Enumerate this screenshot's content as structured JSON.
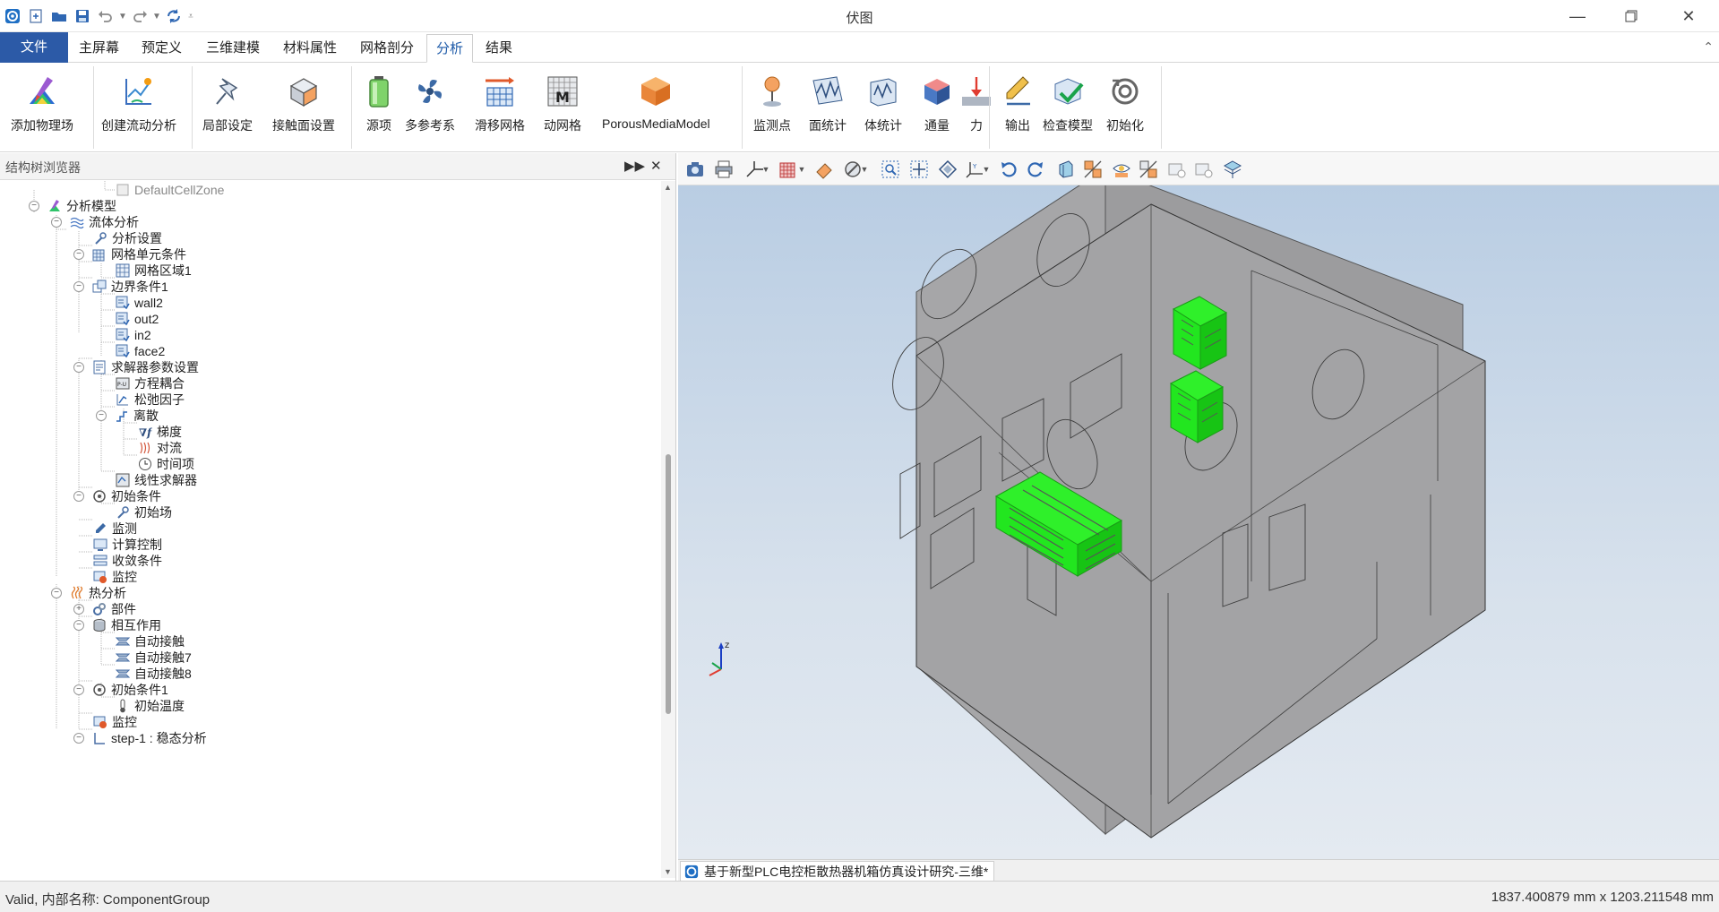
{
  "window": {
    "title": "伏图",
    "controls": [
      "minimize-icon",
      "restore-icon",
      "close-icon"
    ]
  },
  "quick_access": [
    "app-logo-icon",
    "new-file-icon",
    "open-folder-icon",
    "save-icon",
    "undo-icon",
    "redo-icon",
    "refresh-icon",
    "customize-icon"
  ],
  "menu": {
    "tabs": [
      "文件",
      "主屏幕",
      "预定义",
      "三维建模",
      "材料属性",
      "网格剖分",
      "分析",
      "结果"
    ],
    "active": "分析"
  },
  "ribbon": {
    "buttons": {
      "add_physics": "添加物理场",
      "create_flow": "创建流动分析",
      "local_setting": "局部设定",
      "contact_setting": "接触面设置",
      "source": "源项",
      "multi_ref": "多参考系",
      "sliding_mesh": "滑移网格",
      "dynamic_mesh": "动网格",
      "porous_media": "PorousMediaModel",
      "monitor_point": "监测点",
      "surface_stat": "面统计",
      "volume_stat": "体统计",
      "flux": "通量",
      "force": "力",
      "output": "输出",
      "check_model": "检查模型",
      "initialize": "初始化"
    }
  },
  "left_pane": {
    "title": "结构树浏览器",
    "tree": {
      "default_cell_zone": "DefaultCellZone",
      "analysis_model": "分析模型",
      "fluid_analysis": "流体分析",
      "analysis_settings": "分析设置",
      "mesh_cell_conditions": "网格单元条件",
      "mesh_region1": "网格区域1",
      "boundary_conditions1": "边界条件1",
      "wall2": "wall2",
      "out2": "out2",
      "in2": "in2",
      "face2": "face2",
      "solver_params": "求解器参数设置",
      "equation_coupling": "方程耦合",
      "relaxation": "松弛因子",
      "discrete": "离散",
      "gradient": "梯度",
      "convection": "对流",
      "time_term": "时间项",
      "linear_solver": "线性求解器",
      "initial_conditions": "初始条件",
      "initial_field": "初始场",
      "monitoring": "监测",
      "calc_control": "计算控制",
      "convergence": "收敛条件",
      "monitor_ctrl": "监控",
      "thermal_analysis": "热分析",
      "parts": "部件",
      "interactions": "相互作用",
      "auto_contact": "自动接触",
      "auto_contact7": "自动接触7",
      "auto_contact8": "自动接触8",
      "initial_conditions1": "初始条件1",
      "initial_temperature": "初始温度",
      "monitor_ctrl2": "监控",
      "step1": "step-1 : 稳态分析"
    }
  },
  "viewport": {
    "document_tab": "基于新型PLC电控柜散热器机箱仿真设计研究-三维*",
    "axis_label_z": "z",
    "model_color": "#a3a3a5",
    "highlight_color": "#1ef51e"
  },
  "status": {
    "left": "Valid, 内部名称: ComponentGroup",
    "right": "1837.400879 mm x 1203.211548 mm"
  }
}
